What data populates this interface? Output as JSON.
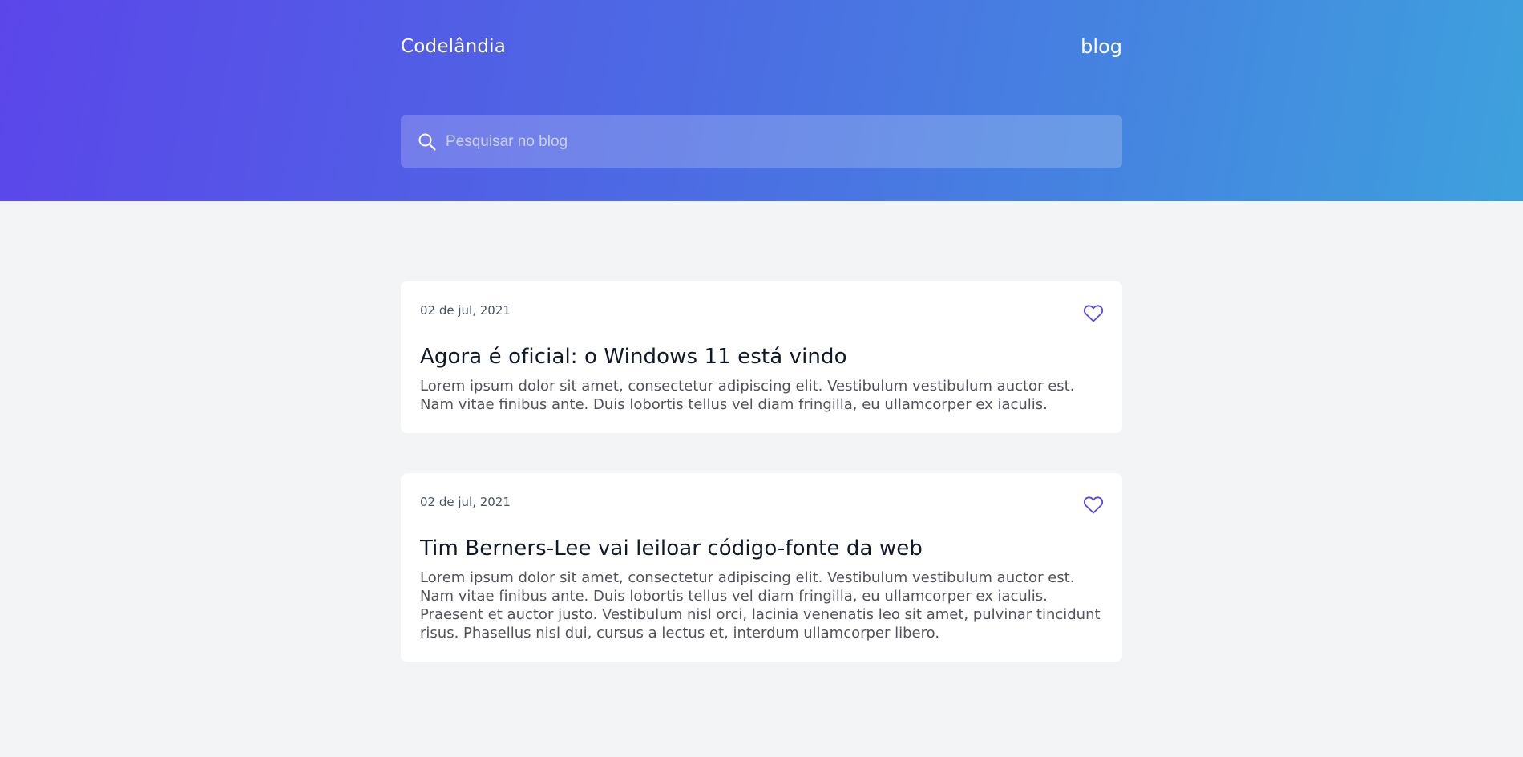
{
  "header": {
    "brand": "Codelândia",
    "nav_link": "blog",
    "search": {
      "placeholder": "Pesquisar no blog",
      "value": "",
      "icon": "search-icon"
    }
  },
  "colors": {
    "gradient_start": "#5b46ea",
    "gradient_end": "#3ea1dd",
    "page_background": "#f3f4f6",
    "card_background": "#ffffff",
    "heart_accent": "#5b46ea"
  },
  "posts": [
    {
      "date": "02 de jul, 2021",
      "title": "Agora é oficial: o Windows 11 está vindo",
      "body": "Lorem ipsum dolor sit amet, consectetur adipiscing elit. Vestibulum vestibulum auctor est. Nam vitae finibus ante. Duis lobortis tellus vel diam fringilla, eu ullamcorper ex iaculis.",
      "icon": "heart-icon"
    },
    {
      "date": "02 de jul, 2021",
      "title": "Tim Berners-Lee vai leiloar código-fonte da web",
      "body": "Lorem ipsum dolor sit amet, consectetur adipiscing elit. Vestibulum vestibulum auctor est. Nam vitae finibus ante. Duis lobortis tellus vel diam fringilla, eu ullamcorper ex iaculis. Praesent et auctor justo. Vestibulum nisl orci, lacinia venenatis leo sit amet, pulvinar tincidunt risus. Phasellus nisl dui, cursus a lectus et, interdum ullamcorper libero.",
      "icon": "heart-icon"
    }
  ]
}
